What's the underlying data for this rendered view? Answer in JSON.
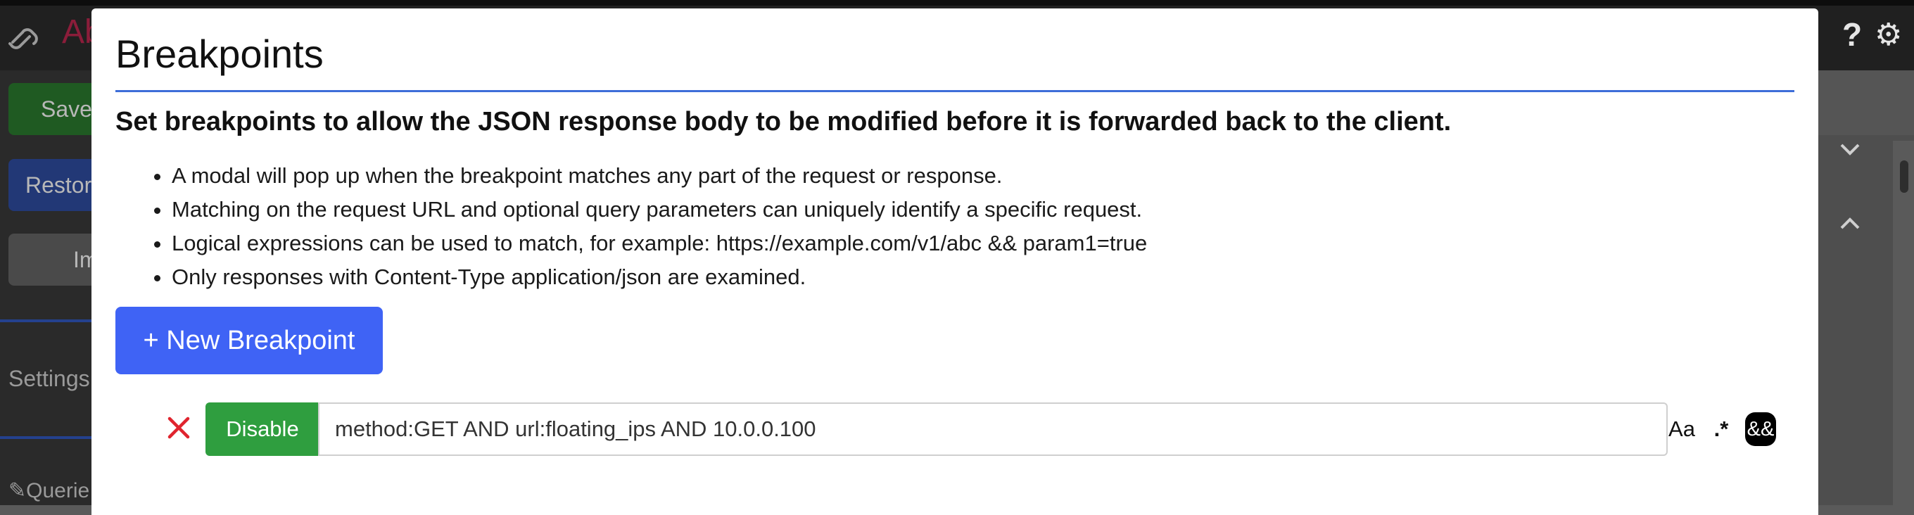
{
  "background": {
    "app_title": "Ab",
    "sidebar": {
      "save_label": "Save",
      "restore_label": "Restore",
      "import_label": "Im",
      "settings_label": "Settings",
      "queries_label": "Querie"
    },
    "header_icons": [
      "help-icon",
      "gear-icon"
    ],
    "help_glyph": "?",
    "gear_glyph": "⚙",
    "chevron_down": "⌄",
    "chevron_up": "⌃"
  },
  "modal": {
    "title": "Breakpoints",
    "lead": "Set breakpoints to allow the JSON response body to be modified before it is forwarded back to the client.",
    "bullets": [
      "A modal will pop up when the breakpoint matches any part of the request or response.",
      "Matching on the request URL and optional query parameters can uniquely identify a specific request.",
      "Logical expressions can be used to match, for example: https://example.com/v1/abc && param1=true",
      "Only responses with Content-Type application/json are examined."
    ],
    "new_breakpoint_label": "+ New Breakpoint",
    "breakpoints": [
      {
        "toggle_label": "Disable",
        "value": "method:GET AND url:floating_ips AND 10.0.0.100",
        "options": {
          "match_case": "Aa",
          "regex": ".*",
          "logical": "&&"
        }
      }
    ]
  },
  "colors": {
    "accent_blue": "#3f63f5",
    "rule_blue": "#3d6dd8",
    "disable_green": "#2f9e3f",
    "delete_red": "#e0242e"
  }
}
